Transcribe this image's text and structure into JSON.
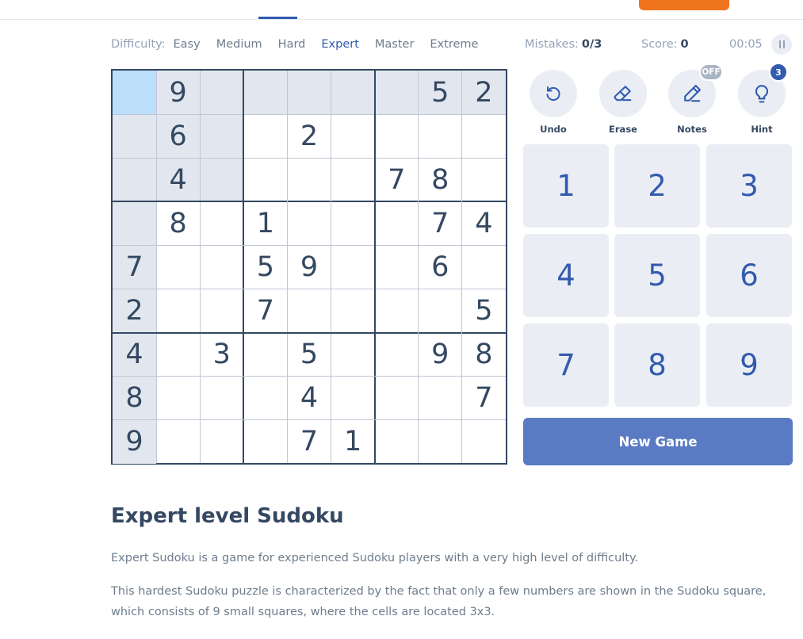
{
  "difficulty": {
    "label": "Difficulty:",
    "levels": [
      "Easy",
      "Medium",
      "Hard",
      "Expert",
      "Master",
      "Extreme"
    ],
    "active": "Expert"
  },
  "status": {
    "mistakes_label": "Mistakes:",
    "mistakes_value": "0/3",
    "score_label": "Score:",
    "score_value": "0",
    "timer": "00:05"
  },
  "board": {
    "rows": [
      [
        "",
        "9",
        "",
        "",
        "",
        "",
        "",
        "5",
        "2"
      ],
      [
        "",
        "6",
        "",
        "",
        "2",
        "",
        "",
        "",
        ""
      ],
      [
        "",
        "4",
        "",
        "",
        "",
        "",
        "7",
        "8",
        ""
      ],
      [
        "",
        "8",
        "",
        "1",
        "",
        "",
        "",
        "7",
        "4"
      ],
      [
        "7",
        "",
        "",
        "5",
        "9",
        "",
        "",
        "6",
        ""
      ],
      [
        "2",
        "",
        "",
        "7",
        "",
        "",
        "",
        "",
        "5"
      ],
      [
        "4",
        "",
        "3",
        "",
        "5",
        "",
        "",
        "9",
        "8"
      ],
      [
        "8",
        "",
        "",
        "",
        "4",
        "",
        "",
        "",
        "7"
      ],
      [
        "9",
        "",
        "",
        "",
        "7",
        "1",
        "",
        "",
        ""
      ]
    ],
    "selected_row": 1,
    "selected_col": 1
  },
  "tools": {
    "undo": "Undo",
    "erase": "Erase",
    "notes": "Notes",
    "notes_badge": "OFF",
    "hint": "Hint",
    "hint_badge": "3",
    "icons": [
      "undo-icon",
      "eraser-icon",
      "pencil-icon",
      "lightbulb-icon"
    ]
  },
  "numpad": [
    "1",
    "2",
    "3",
    "4",
    "5",
    "6",
    "7",
    "8",
    "9"
  ],
  "new_game": "New Game",
  "article": {
    "title": "Expert level Sudoku",
    "p1": "Expert Sudoku is a game for experienced Sudoku players with a very high level of difficulty.",
    "p2": "This hardest Sudoku puzzle is characterized by the fact that only a few numbers are shown in the Sudoku square, which consists of 9 small squares, where the cells are located 3x3."
  },
  "colors": {
    "accent": "#325aaf",
    "text": "#344861",
    "highlight": "#e2e7ef",
    "selected": "#bbdefb",
    "button_bg": "#eaeef4",
    "new_game_bg": "#5a7bc4",
    "top_accent": "#f0741e"
  }
}
